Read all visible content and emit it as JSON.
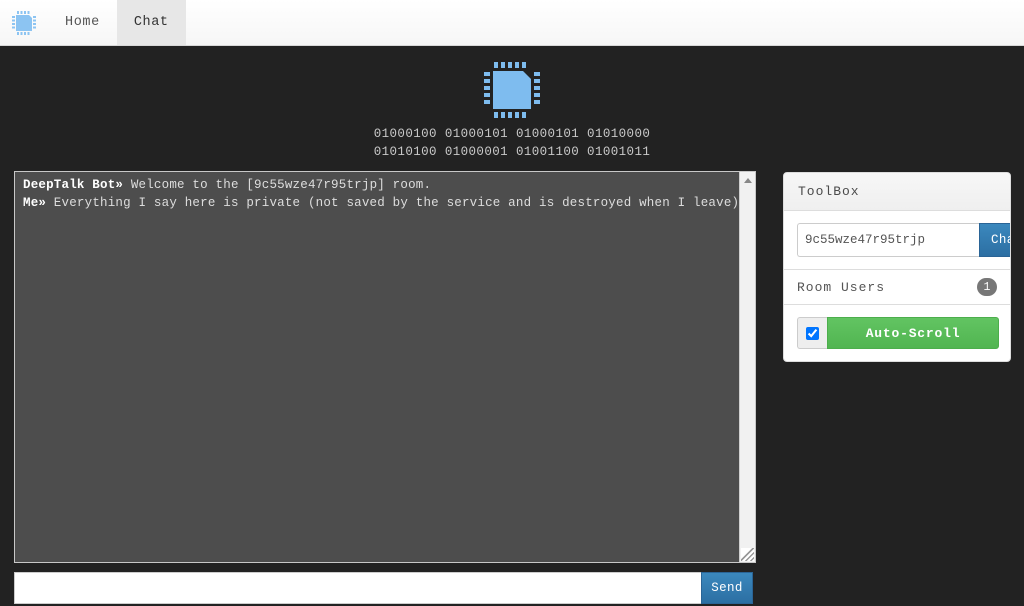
{
  "navbar": {
    "brand_icon": "chip-icon",
    "items": [
      {
        "label": "Home",
        "active": false
      },
      {
        "label": "Chat",
        "active": true
      }
    ]
  },
  "hero": {
    "logo_icon": "chip-icon",
    "binary_line_1": "01000100 01000101 01000101 01010000",
    "binary_line_2": "01010100 01000001 01001100 01001011"
  },
  "chat": {
    "messages": [
      {
        "sender": "DeepTalk Bot»",
        "text": " Welcome to the [9c55wze47r95trjp] room."
      },
      {
        "sender": "Me»",
        "text": " Everything I say here is private (not saved by the service and is destroyed when I leave)."
      }
    ],
    "message_input_value": "",
    "message_input_placeholder": "",
    "send_label": "Send"
  },
  "toolbox": {
    "title": "ToolBox",
    "room_input_value": "9c55wze47r95trjp",
    "room_input_placeholder": "",
    "change_label": "Change",
    "room_users_label": "Room Users",
    "room_users_count": "1",
    "autoscroll_label": "Auto-Scroll",
    "autoscroll_checked": true
  },
  "colors": {
    "page_background": "#222222",
    "chat_background": "#4d4d4d",
    "accent_blue": "#2c6fa3",
    "logo_blue": "#7ebcef",
    "success_green": "#51b551",
    "badge_gray": "#777777"
  }
}
